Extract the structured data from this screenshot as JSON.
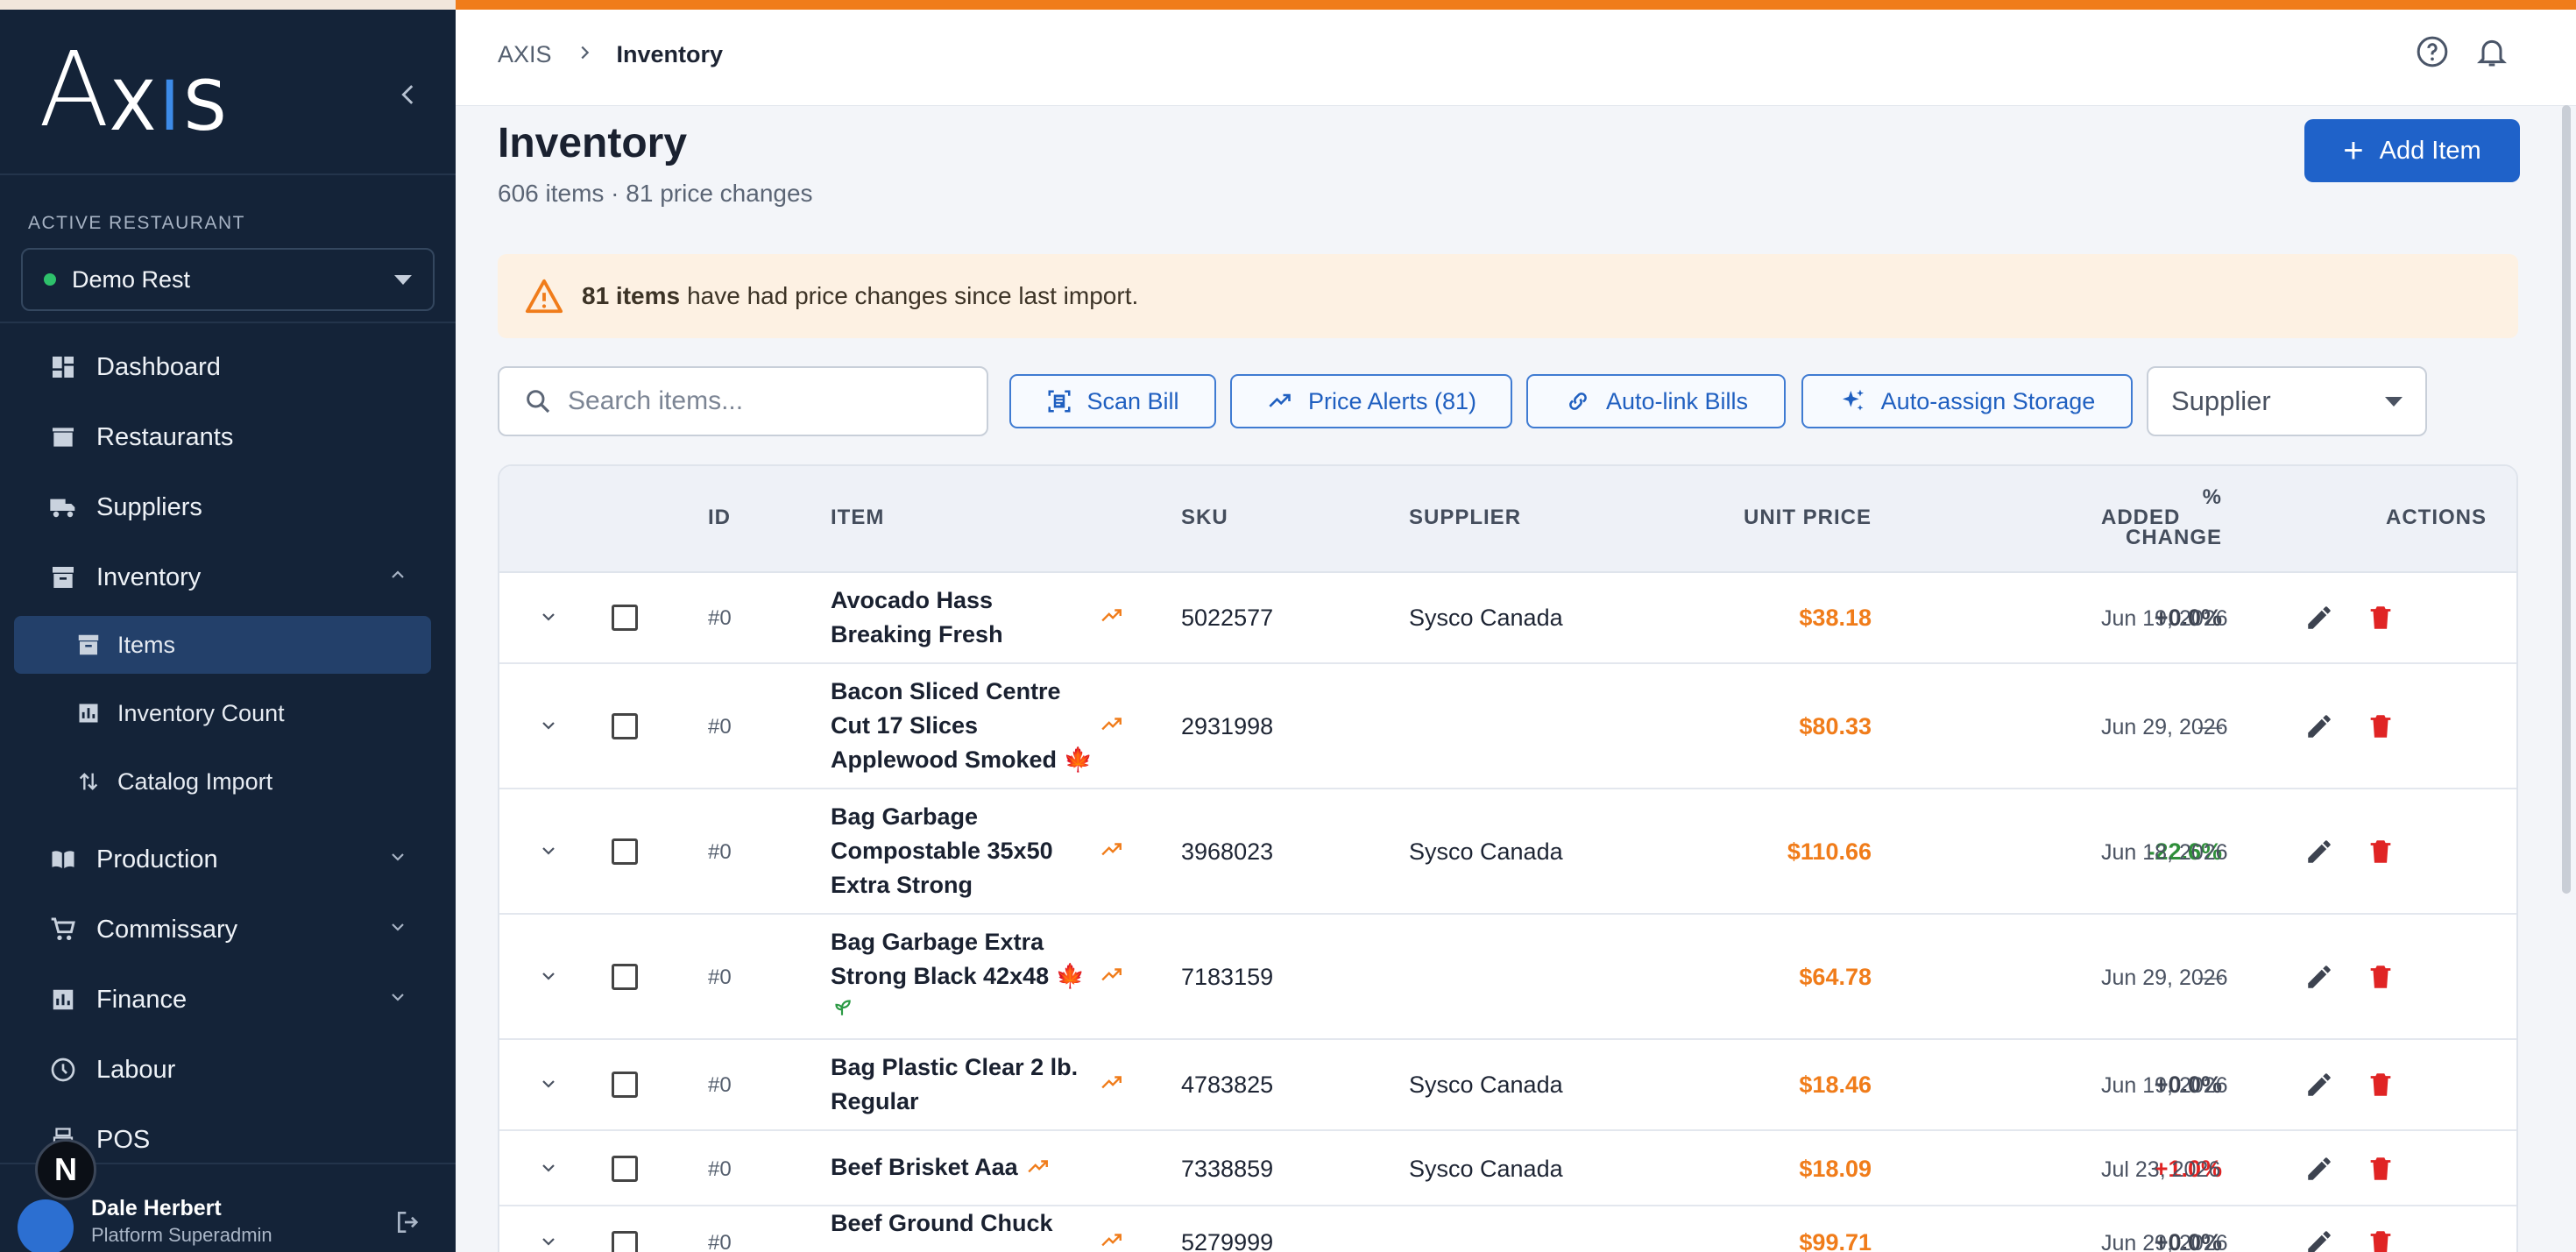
{
  "sidebar": {
    "logo_a": "A",
    "logo_rest": "XIS",
    "active_restaurant_label": "ACTIVE RESTAURANT",
    "restaurant_name": "Demo Rest",
    "nav": [
      {
        "label": "Dashboard",
        "icon": "dashboard-icon"
      },
      {
        "label": "Restaurants",
        "icon": "store-icon"
      },
      {
        "label": "Suppliers",
        "icon": "truck-icon"
      },
      {
        "label": "Inventory",
        "icon": "archive-icon"
      },
      {
        "label": "Production",
        "icon": "book-icon"
      },
      {
        "label": "Commissary",
        "icon": "cart-icon"
      },
      {
        "label": "Finance",
        "icon": "bar-chart-icon"
      },
      {
        "label": "Labour",
        "icon": "clock-icon"
      },
      {
        "label": "POS",
        "icon": "register-icon"
      }
    ],
    "inventory_sub": [
      {
        "label": "Items",
        "icon": "archive-icon"
      },
      {
        "label": "Inventory Count",
        "icon": "bar-chart-icon"
      },
      {
        "label": "Catalog Import",
        "icon": "sort-icon"
      }
    ],
    "user": {
      "name": "Dale Herbert",
      "role": "Platform Superadmin",
      "badge": "N"
    }
  },
  "header": {
    "breadcrumb_root": "AXIS",
    "breadcrumb_current": "Inventory"
  },
  "page": {
    "title": "Inventory",
    "subtitle": "606 items · 81 price changes",
    "add_button": "Add Item"
  },
  "alert": {
    "count_text": "81 items",
    "message": "have had price changes since last import."
  },
  "toolbar": {
    "search_placeholder": "Search items...",
    "scan_bill": "Scan Bill",
    "price_alerts": "Price Alerts (81)",
    "auto_link": "Auto-link Bills",
    "auto_assign": "Auto-assign Storage",
    "supplier_filter": "Supplier"
  },
  "table": {
    "headers": {
      "id": "ID",
      "item": "ITEM",
      "sku": "SKU",
      "supplier": "SUPPLIER",
      "unit_price": "UNIT PRICE",
      "pct": "%",
      "change": "CHANGE",
      "added": "ADDED",
      "actions": "ACTIONS"
    },
    "rows": [
      {
        "id": "#0",
        "item": [
          "Avocado Hass",
          "Breaking Fresh"
        ],
        "sku": "5022577",
        "supplier": "Sysco Canada",
        "price": "$38.18",
        "change": "+0.0%",
        "change_color": "#3d4350",
        "added": "Jun 19, 2026"
      },
      {
        "id": "#0",
        "item": [
          "Bacon Sliced Centre",
          "Cut 17 Slices",
          "Applewood Smoked"
        ],
        "sku": "2931998",
        "supplier": "",
        "price": "$80.33",
        "change": "—",
        "change_color": "#6b7280",
        "added": "Jun 29, 2026"
      },
      {
        "id": "#0",
        "item": [
          "Bag Garbage",
          "Compostable 35x50",
          "Extra Strong"
        ],
        "sku": "3968023",
        "supplier": "Sysco Canada",
        "price": "$110.66",
        "change": "-22.6%",
        "change_color": "#2f8f3a",
        "added": "Jun 18, 2026"
      },
      {
        "id": "#0",
        "item": [
          "Bag Garbage Extra",
          "Strong Black 42x48"
        ],
        "sku": "7183159",
        "supplier": "",
        "price": "$64.78",
        "change": "—",
        "change_color": "#6b7280",
        "added": "Jun 29, 2026"
      },
      {
        "id": "#0",
        "item": [
          "Bag Plastic Clear 2 lb.",
          "Regular"
        ],
        "sku": "4783825",
        "supplier": "Sysco Canada",
        "price": "$18.46",
        "change": "+0.0%",
        "change_color": "#3d4350",
        "added": "Jun 19, 2026"
      },
      {
        "id": "#0",
        "item": [
          "Beef Brisket Aaa"
        ],
        "sku": "7338859",
        "supplier": "Sysco Canada",
        "price": "$18.09",
        "change": "+1.0%",
        "change_color": "#e02424",
        "added": "Jul 23, 2026"
      },
      {
        "id": "#0",
        "item": [
          "Beef Ground Chuck"
        ],
        "sku": "5279999",
        "supplier": "",
        "price": "$99.71",
        "change": "+0.0%",
        "change_color": "#3d4350",
        "added": "Jun 29, 2026"
      }
    ]
  },
  "colors": {
    "accent": "#f07c1a",
    "brand": "#1f62c9",
    "sidebar": "#142338"
  }
}
